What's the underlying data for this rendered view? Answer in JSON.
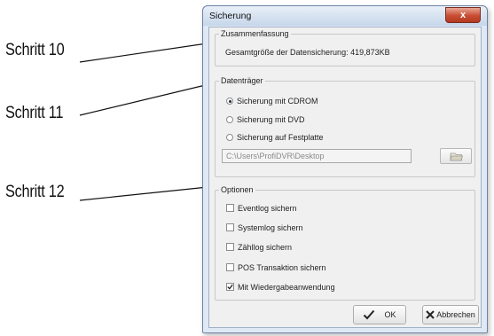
{
  "annotations": [
    {
      "label": "Schritt 10"
    },
    {
      "label": "Schritt 11"
    },
    {
      "label": "Schritt 12"
    }
  ],
  "dialog": {
    "title": "Sicherung",
    "close_glyph": "x",
    "summary": {
      "legend": "Zusammenfassung",
      "size_text": "Gesamtgröße der Datensicherung: 419,873KB"
    },
    "media": {
      "legend": "Datenträger",
      "options": [
        {
          "label": "Sicherung mit CDROM",
          "checked": true
        },
        {
          "label": "Sicherung mit DVD",
          "checked": false
        },
        {
          "label": "Sicherung auf Festplatte",
          "checked": false
        }
      ],
      "path_value": "C:\\Users\\ProfiDVR\\Desktop",
      "browse_icon": "folder-icon"
    },
    "options": {
      "legend": "Optionen",
      "items": [
        {
          "label": "Eventlog sichern",
          "checked": false
        },
        {
          "label": "Systemlog sichern",
          "checked": false
        },
        {
          "label": "Zähllog sichern",
          "checked": false
        },
        {
          "label": "POS Transaktion sichern",
          "checked": false
        },
        {
          "label": "Mit Wiedergabeanwendung",
          "checked": true
        }
      ]
    },
    "buttons": {
      "ok_label": "OK",
      "cancel_label": "Abbrechen"
    }
  },
  "colors": {
    "window_frame": "#dfe9f5",
    "close_button": "#c84d32"
  }
}
